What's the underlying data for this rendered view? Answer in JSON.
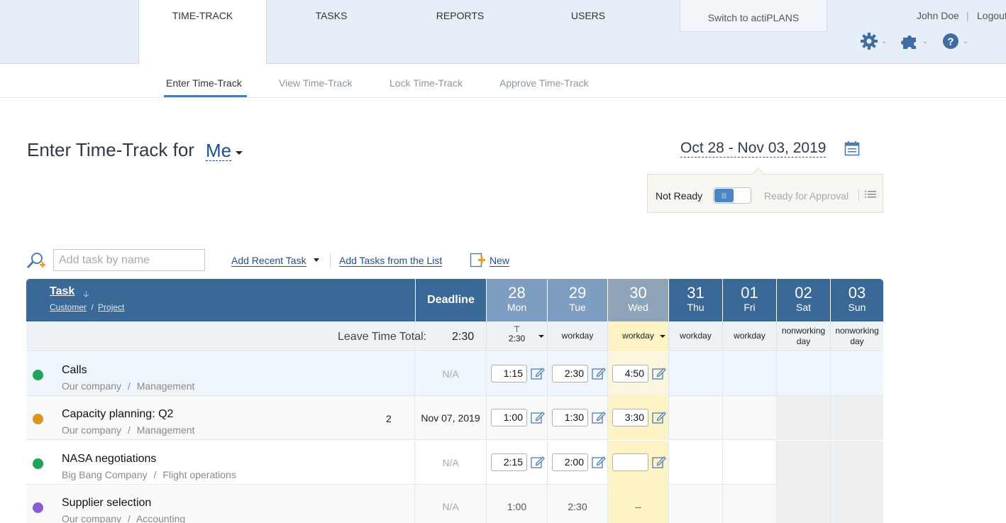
{
  "header": {
    "tabs": [
      {
        "label": "TIME-TRACK"
      },
      {
        "label": "TASKS"
      },
      {
        "label": "REPORTS"
      },
      {
        "label": "USERS"
      }
    ],
    "switch_label": "Switch to actiPLANS",
    "user_name": "John Doe",
    "separator": "|",
    "logout_label": "Logout",
    "icons": [
      "gear-icon",
      "puzzle-icon",
      "help-icon"
    ]
  },
  "subnav": {
    "items": [
      {
        "label": "Enter Time-Track"
      },
      {
        "label": "View Time-Track"
      },
      {
        "label": "Lock Time-Track"
      },
      {
        "label": "Approve Time-Track"
      }
    ]
  },
  "page": {
    "title": "Enter Time-Track for",
    "user_select": "Me",
    "date_range": "Oct 28 - Nov 03, 2019",
    "status_left": "Not Ready",
    "status_right": "Ready for Approval"
  },
  "toolbar": {
    "search_placeholder": "Add task by name",
    "add_recent": "Add Recent Task",
    "add_from_list": "Add Tasks from the List",
    "new_label": "New"
  },
  "grid": {
    "task_header": "Task",
    "customer_header": "Customer",
    "project_header": "Project",
    "sub_sep": "/",
    "deadline_header": "Deadline",
    "days": [
      {
        "num": "28",
        "name": "Mon",
        "state": "past"
      },
      {
        "num": "29",
        "name": "Tue",
        "state": "past"
      },
      {
        "num": "30",
        "name": "Wed",
        "state": "today"
      },
      {
        "num": "31",
        "name": "Thu",
        "state": "future"
      },
      {
        "num": "01",
        "name": "Fri",
        "state": "future"
      },
      {
        "num": "02",
        "name": "Sat",
        "state": "future"
      },
      {
        "num": "03",
        "name": "Sun",
        "state": "future"
      }
    ],
    "leave_label": "Leave Time Total:",
    "leave_total": "2:30",
    "day_types": [
      {
        "top": "⊤",
        "bottom": "2:30"
      },
      {
        "top": "workday",
        "bottom": ""
      },
      {
        "top": "workday",
        "bottom": ""
      },
      {
        "top": "workday",
        "bottom": ""
      },
      {
        "top": "workday",
        "bottom": ""
      },
      {
        "top": "nonworking",
        "bottom": "day"
      },
      {
        "top": "nonworking",
        "bottom": "day"
      }
    ],
    "rows": [
      {
        "name": "Calls",
        "customer": "Our company",
        "project": "Management",
        "count": "",
        "deadline": "N/A",
        "color": "#1fa35a",
        "times": [
          "1:15",
          "2:30",
          "4:50"
        ]
      },
      {
        "name": "Capacity planning: Q2",
        "customer": "Our company",
        "project": "Management",
        "count": "2",
        "deadline": "Nov 07, 2019",
        "color": "#d8961b",
        "times": [
          "1:00",
          "1:30",
          "3:30"
        ]
      },
      {
        "name": "NASA negotiations",
        "customer": "Big Bang Company",
        "project": "Flight operations",
        "count": "",
        "deadline": "N/A",
        "color": "#1fa35a",
        "times": [
          "2:15",
          "2:00",
          ""
        ]
      },
      {
        "name": "Supplier selection",
        "customer": "Our company",
        "project": "Accounting",
        "count": "",
        "deadline": "N/A",
        "color": "#8a5bd6",
        "readonly": [
          "1:00",
          "2:30",
          "--"
        ]
      }
    ]
  }
}
